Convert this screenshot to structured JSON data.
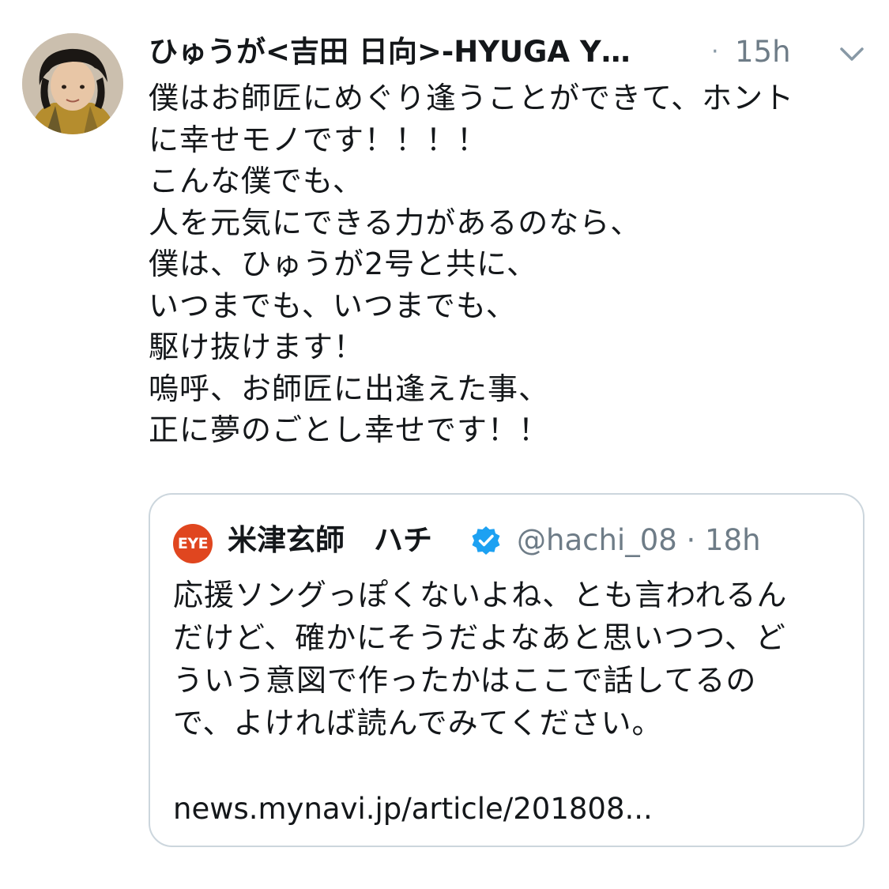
{
  "tweet": {
    "display_name": "ひゅうが<吉田 日向>-HYUGA Y…",
    "separator": "·",
    "time": "15h",
    "body_lines": [
      "僕はお師匠にめぐり逢うことができて、ホント",
      "に幸せモノです！！！！",
      "こんな僕でも、",
      "人を元気にできる力があるのなら、",
      "僕は、ひゅうが2号と共に、",
      "いつまでも、いつまでも、",
      "駆け抜けます！",
      "嗚呼、お師匠に出逢えた事、",
      "正に夢のごとし幸せです！！"
    ]
  },
  "quoted": {
    "logo_text": "EYE",
    "name": "米津玄師　ハチ",
    "handle_time": "@hachi_08 · 18h",
    "text_lines": [
      "応援ソングっぽくないよね、とも言われるん",
      "だけど、確かにそうだよなあと思いつつ、ど",
      "ういう意図で作ったかはここで話してるの",
      "で、よければ読んでみてください。"
    ],
    "link": "news.mynavi.jp/article/201808..."
  },
  "colors": {
    "text": "#14171a",
    "secondary": "#6e7c87",
    "border": "#ccd6dd",
    "verified": "#1da1f2",
    "logo_bg": "#e0461f"
  },
  "icons": {
    "menu": "chevron-down-icon",
    "verified": "verified-badge-icon"
  }
}
